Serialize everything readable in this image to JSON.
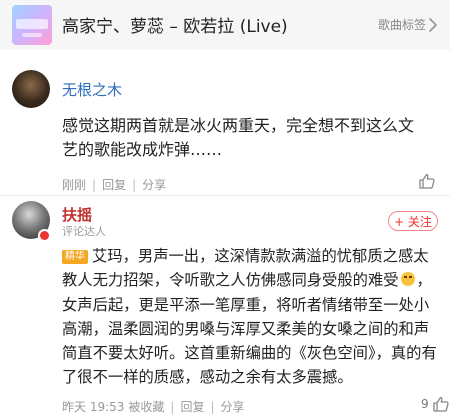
{
  "song": {
    "title": "高家宁、萝蕊 – 欧若拉 (Live)",
    "tag_label": "歌曲标签",
    "cover_icon": "album-cover",
    "chevron_icon": "chevron-right-icon"
  },
  "comments": [
    {
      "username": "无根之木",
      "text": "感觉这期两首就是冰火两重天，完全想不到这么文艺的歌能改成炸弹……",
      "time": "刚刚",
      "reply_label": "回复",
      "share_label": "分享",
      "likes": ""
    },
    {
      "username": "扶摇",
      "role": "评论达人",
      "follow_label": "+ 关注",
      "pick_badge": "精华",
      "text_part1": "艾玛，男声一出，这深情款款满溢的忧郁质之感太教人无力招架，令听歌之人仿佛感同身受般的难受",
      "text_part2": "，女声后起，更是平添一笔厚重，将听者情绪带至一处小高潮，温柔圆润的男嗓与浑厚又柔美的女嗓之间的和声简直不要太好听。这首重新编曲的《灰色空间》，真的有了很不一样的质感，感动之余有太多震撼。",
      "time": "昨天 19:53",
      "edited_label": "被收藏",
      "reply_label": "回复",
      "share_label": "分享",
      "likes": "9"
    }
  ],
  "colors": {
    "username": "#2e6dbb",
    "highlight_name": "#c0312f",
    "pick_badge": "#f5a623",
    "follow": "#e33333"
  }
}
